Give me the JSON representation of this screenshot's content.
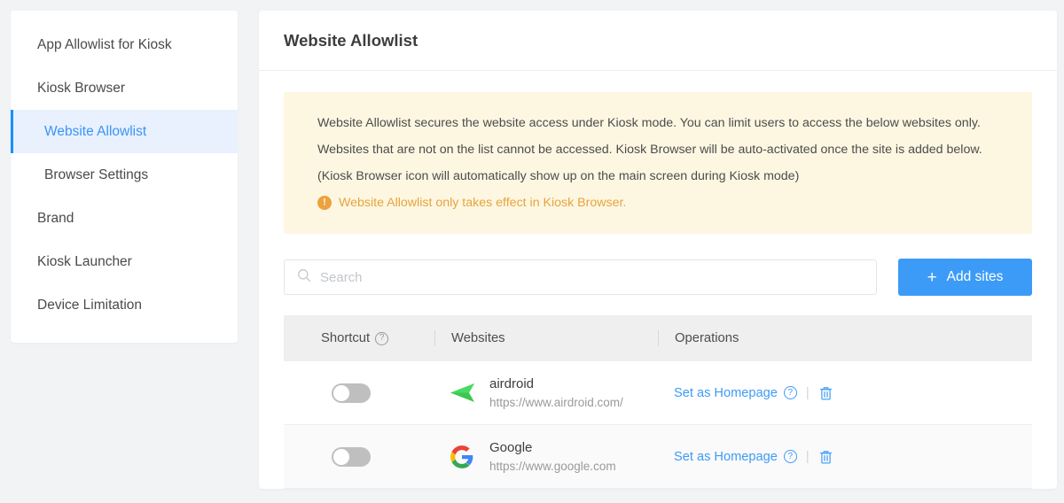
{
  "sidebar": {
    "items": [
      {
        "label": "App Allowlist for Kiosk",
        "level": "parent",
        "active": false
      },
      {
        "label": "Kiosk Browser",
        "level": "parent",
        "active": false
      },
      {
        "label": "Website Allowlist",
        "level": "child",
        "active": true
      },
      {
        "label": "Browser Settings",
        "level": "child",
        "active": false
      },
      {
        "label": "Brand",
        "level": "parent",
        "active": false
      },
      {
        "label": "Kiosk Launcher",
        "level": "parent",
        "active": false
      },
      {
        "label": "Device Limitation",
        "level": "parent",
        "active": false
      }
    ]
  },
  "header": {
    "title": "Website Allowlist"
  },
  "notice": {
    "body": "Website Allowlist secures the website access under Kiosk mode. You can limit users to access the below websites only. Websites that are not on the list cannot be accessed. Kiosk Browser will be auto-activated once the site is added below. (Kiosk Browser icon will automatically show up on the main screen during Kiosk mode)",
    "warning": "Website Allowlist only takes effect in Kiosk Browser.",
    "warning_icon": "exclamation-circle-icon",
    "bg_color": "#fdf7e2",
    "warning_color": "#e8a33d"
  },
  "toolbar": {
    "search_placeholder": "Search",
    "search_value": "",
    "search_icon": "search-icon",
    "add_label": "Add sites",
    "add_icon": "plus-icon",
    "add_color": "#3c9bf7"
  },
  "table": {
    "columns": [
      {
        "key": "shortcut",
        "label": "Shortcut",
        "help": "?"
      },
      {
        "key": "websites",
        "label": "Websites"
      },
      {
        "key": "operations",
        "label": "Operations"
      }
    ],
    "rows": [
      {
        "shortcut_enabled": false,
        "favicon": "airdroid-arrow-icon",
        "name": "airdroid",
        "url": "https://www.airdroid.com/",
        "operation_label": "Set as Homepage",
        "operation_help": "?",
        "delete_icon": "trash-icon"
      },
      {
        "shortcut_enabled": false,
        "favicon": "google-g-icon",
        "name": "Google",
        "url": "https://www.google.com",
        "operation_label": "Set as Homepage",
        "operation_help": "?",
        "delete_icon": "trash-icon"
      }
    ]
  },
  "colors": {
    "accent": "#3c9bf7",
    "active_nav_bg": "#e8f1fd",
    "active_nav_bar": "#1890ff",
    "page_bg": "#f2f3f5",
    "header_row_bg": "#efefef"
  }
}
